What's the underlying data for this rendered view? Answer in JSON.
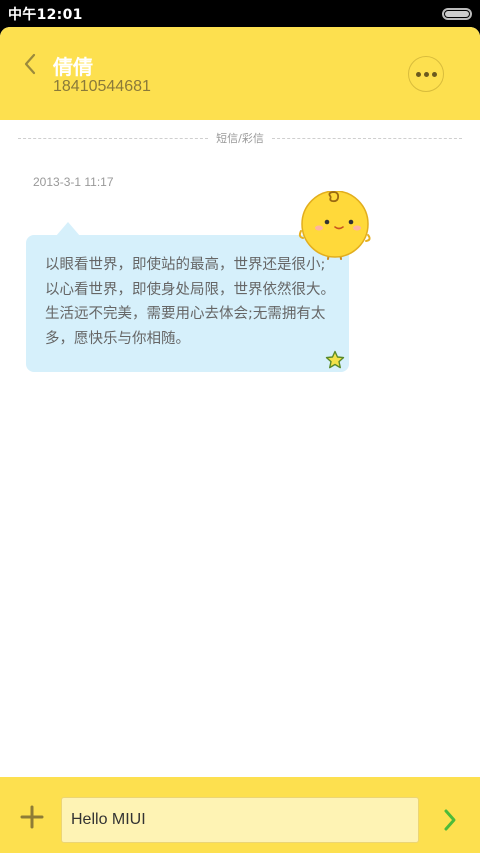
{
  "status_bar": {
    "time": "中午12:01"
  },
  "header": {
    "contact_name": "倩倩",
    "contact_number": "18410544681"
  },
  "conversation": {
    "channel_label": "短信/彩信",
    "messages": [
      {
        "timestamp": "2013-3-1 11:17",
        "text": "以眼看世界，即使站的最高，世界还是很小;以心看世界，即使身处局限，世界依然很大。生活远不完美，需要用心去体会;无需拥有太多，愿快乐与你相随。",
        "starred": true
      }
    ]
  },
  "composer": {
    "input_value": "Hello MIUI"
  },
  "colors": {
    "accent": "#fde04f",
    "bubble": "#d6f0fb",
    "send": "#4cbb3a"
  },
  "icons": {
    "back": "chevron-left-icon",
    "more": "more-dots-icon",
    "add": "plus-icon",
    "send": "chevron-right-icon",
    "star": "star-icon"
  }
}
